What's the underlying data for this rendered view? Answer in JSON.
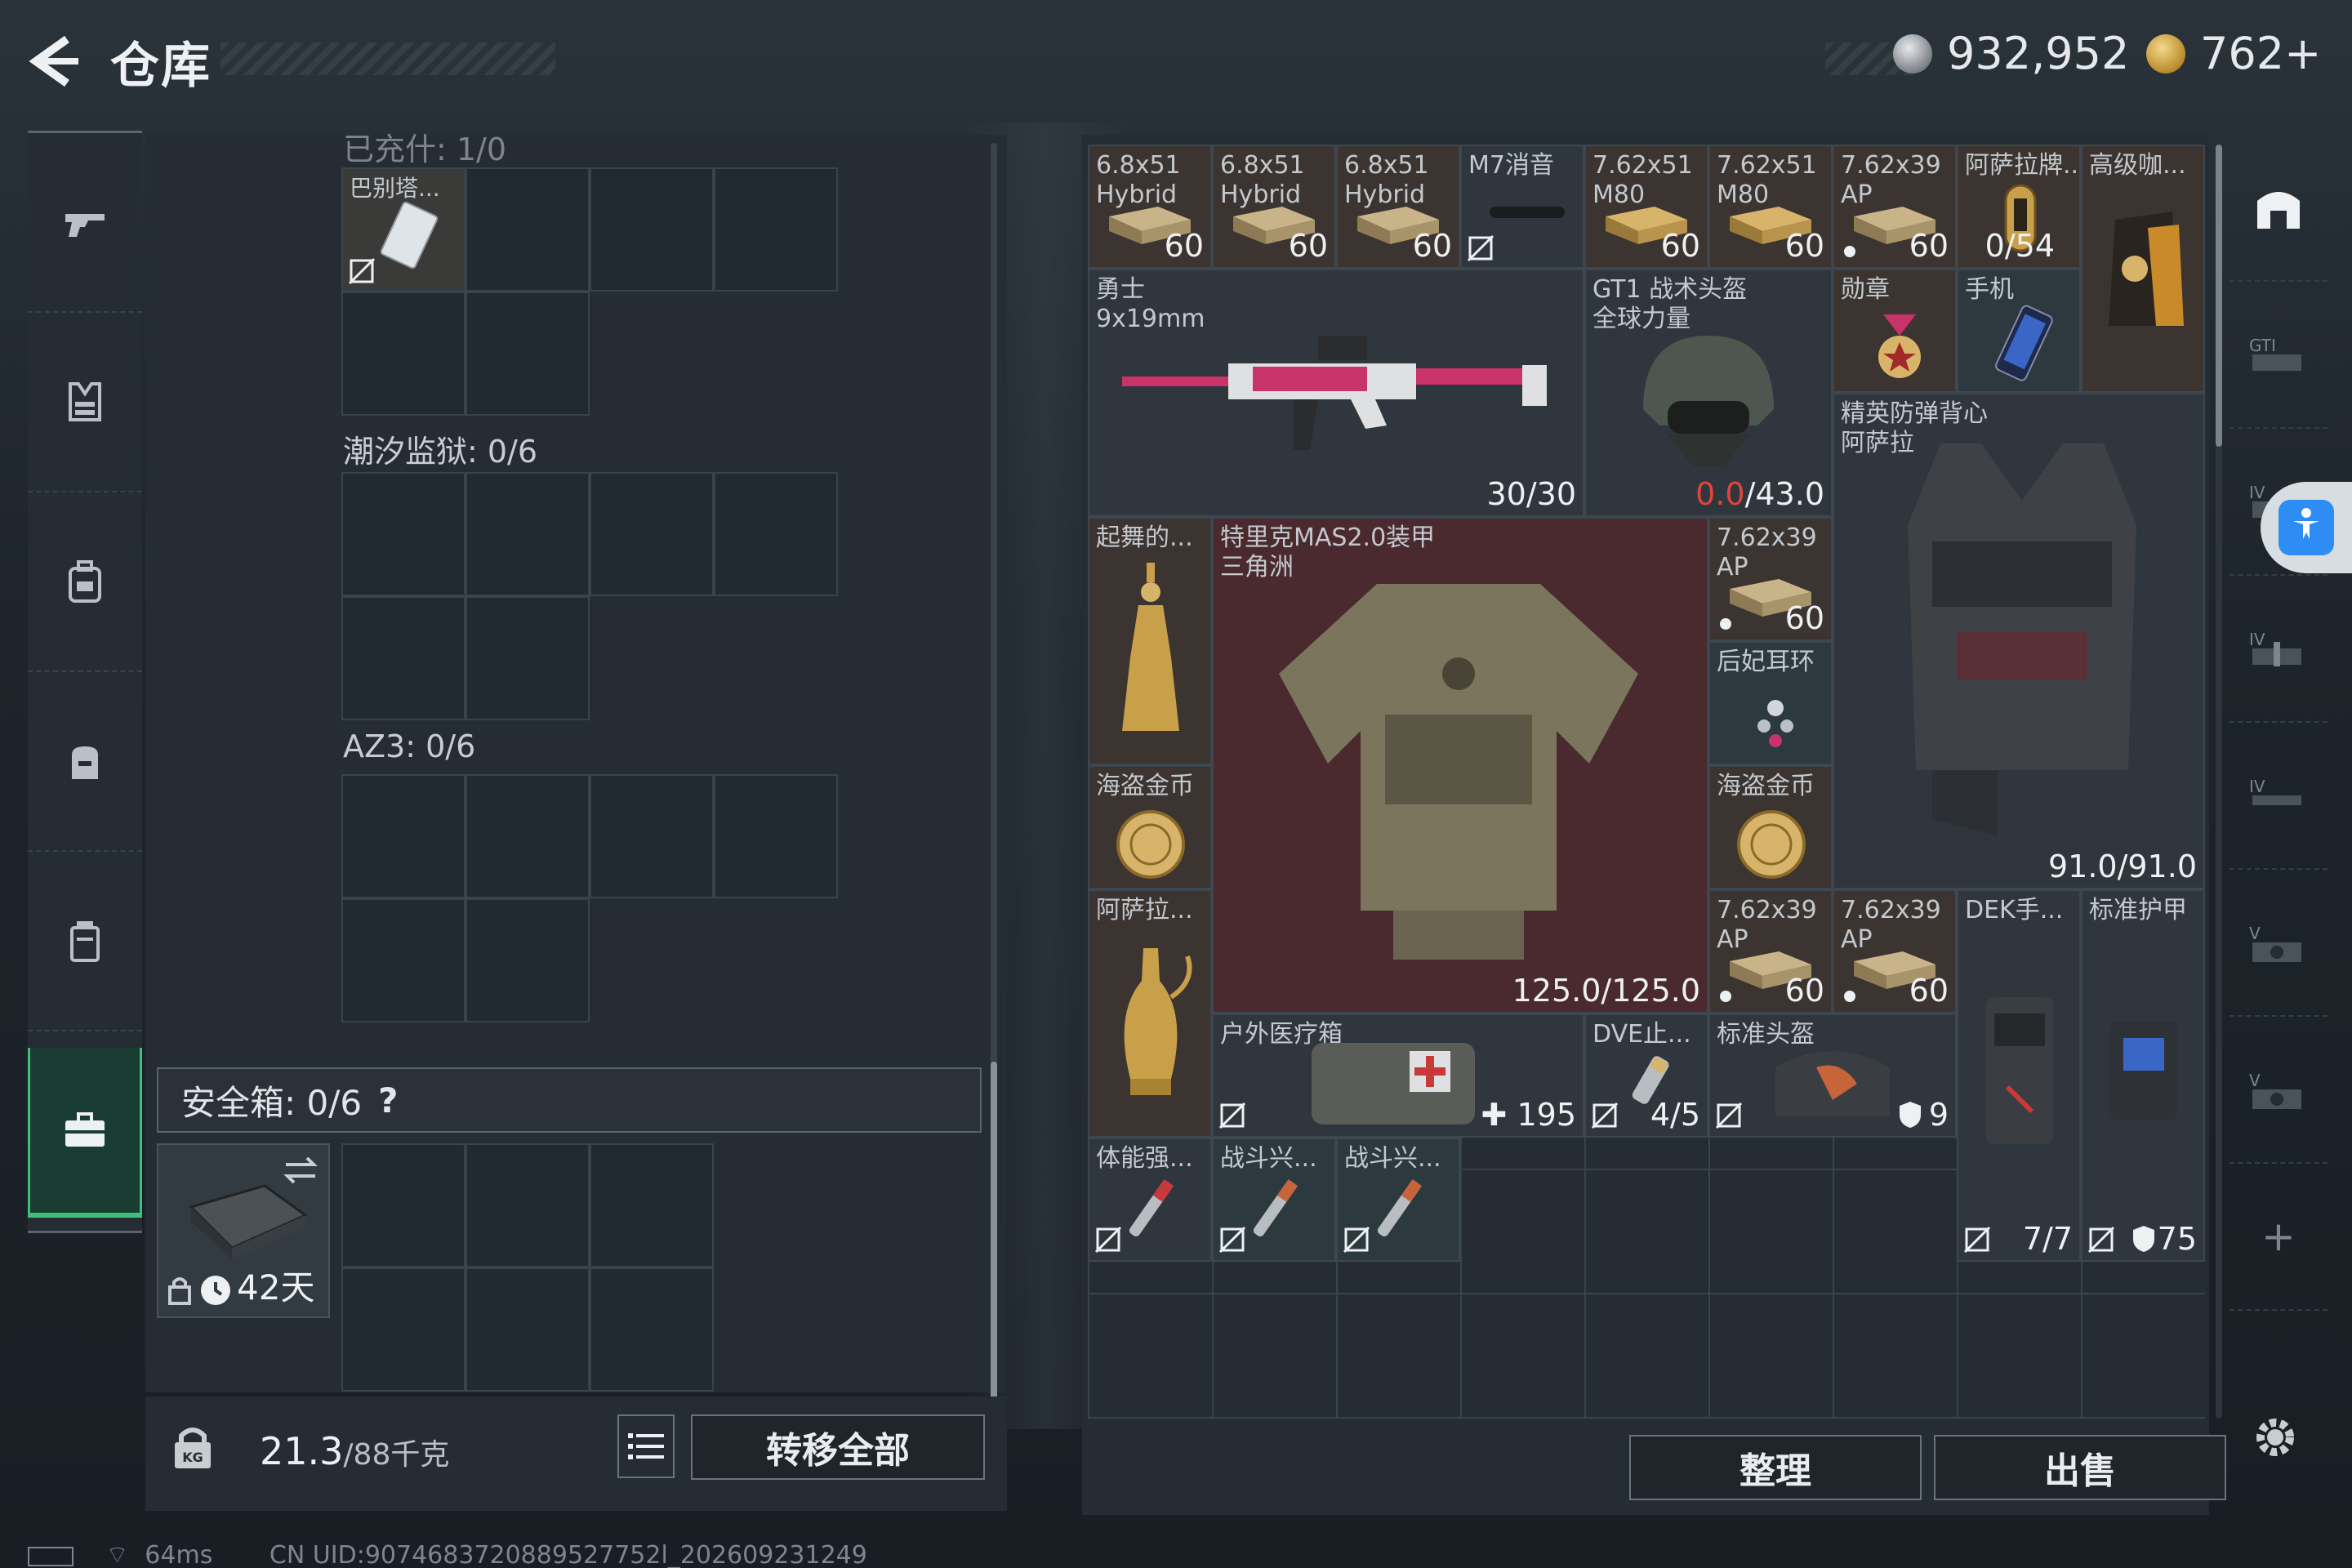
{
  "header": {
    "title": "仓库",
    "silver_amount": "932,952",
    "gold_amount": "762+"
  },
  "left_panel": {
    "top_label_partial": "已充什: 1/0",
    "card_item_name": "巴别塔...",
    "section2_label": "潮汐监狱: 0/6",
    "section3_label": "AZ3: 0/6",
    "safebox_label": "安全箱: 0/6",
    "safebox_help": "?",
    "safe_item_timer": "42天"
  },
  "weight": {
    "current": "21.3",
    "max": "/88千克"
  },
  "buttons": {
    "transfer_all": "转移全部",
    "sort": "整理",
    "sell": "出售"
  },
  "items": [
    {
      "name": "6.8x51\nHybrid",
      "count": "60"
    },
    {
      "name": "6.8x51\nHybrid",
      "count": "60"
    },
    {
      "name": "6.8x51\nHybrid",
      "count": "60"
    },
    {
      "name": "M7消音",
      "count": ""
    },
    {
      "name": "7.62x51\nM80",
      "count": "60"
    },
    {
      "name": "7.62x51\nM80",
      "count": "60"
    },
    {
      "name": "7.62x39\nAP",
      "count": "60"
    },
    {
      "name": "阿萨拉牌...",
      "count": "0/54"
    },
    {
      "name": "高级咖...",
      "count": ""
    },
    {
      "name": "勇士\n9x19mm",
      "count": "30/30"
    },
    {
      "name": "GT1 战术头盔\n全球力量",
      "count_red": "0.0",
      "count": "/43.0"
    },
    {
      "name": "勋章",
      "count": ""
    },
    {
      "name": "手机",
      "count": ""
    },
    {
      "name": "精英防弹背心\n阿萨拉",
      "count": "91.0/91.0"
    },
    {
      "name": "起舞的...",
      "count": ""
    },
    {
      "name": "特里克MAS2.0装甲\n三角洲",
      "count": "125.0/125.0"
    },
    {
      "name": "7.62x39\nAP",
      "count": "60"
    },
    {
      "name": "后妃耳环",
      "count": ""
    },
    {
      "name": "海盗金币",
      "count": ""
    },
    {
      "name": "海盗金币",
      "count": ""
    },
    {
      "name": "阿萨拉...",
      "count": ""
    },
    {
      "name": "7.62x39\nAP",
      "count": "60"
    },
    {
      "name": "7.62x39\nAP",
      "count": "60"
    },
    {
      "name": "DEK手...",
      "count": "7/7"
    },
    {
      "name": "标准护甲",
      "count": "75"
    },
    {
      "name": "户外医疗箱",
      "count": "195"
    },
    {
      "name": "DVE止...",
      "count": "4/5"
    },
    {
      "name": "标准头盔",
      "count": "9"
    },
    {
      "name": "体能强...",
      "count": ""
    },
    {
      "name": "战斗兴...",
      "count": ""
    },
    {
      "name": "战斗兴...",
      "count": ""
    }
  ],
  "side_labels": {
    "gti": "GTI",
    "iv1": "IV",
    "iv2": "IV",
    "iv3": "IV",
    "v1": "V",
    "v2": "V",
    "plus": "+"
  },
  "status": {
    "ping": "64ms",
    "uid": "CN UID:9074683720889527752l_202609231249"
  },
  "colors": {
    "accent_green": "#3fc07a",
    "durability_red": "#e0433c",
    "panel_bg": "#252c33",
    "rare_red_bg": "#4a2a2e"
  }
}
